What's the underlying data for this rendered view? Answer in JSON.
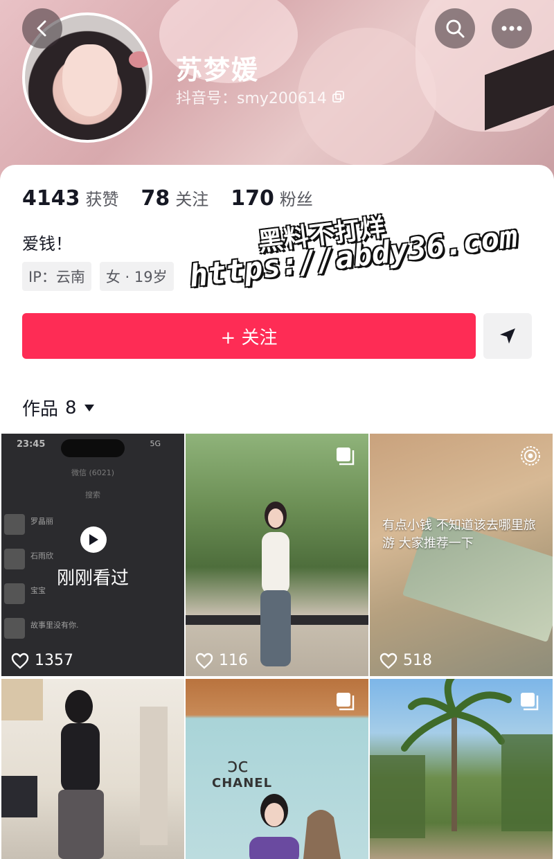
{
  "profile": {
    "name": "苏梦媛",
    "douyin_id": "抖音号：smy200614",
    "bio": "爱钱！",
    "tags": [
      "IP：云南",
      "女 · 19岁"
    ]
  },
  "stats": [
    {
      "num": "4143",
      "label": "获赞"
    },
    {
      "num": "78",
      "label": "关注"
    },
    {
      "num": "170",
      "label": "粉丝"
    }
  ],
  "actions": {
    "follow_label": "+ 关注"
  },
  "works": {
    "label": "作品",
    "count": "8"
  },
  "watermark": {
    "line1": "黑料不打烊",
    "line2": "https://abdy36.com"
  },
  "tiles": [
    {
      "likes": "1357",
      "overlay": "刚刚看过",
      "phone_time": "23:45",
      "phone_status": "5G",
      "wechat_title": "微信 (6021)",
      "search": "搜索",
      "chats": [
        "罗晶丽",
        "石雨欣",
        "宝宝",
        "故事里没有你."
      ]
    },
    {
      "likes": "116"
    },
    {
      "likes": "518",
      "caption": "有点小钱 不知道该去哪里旅游 大家推荐一下"
    },
    {},
    {
      "logo_text": "CHANEL"
    },
    {}
  ],
  "colors": {
    "accent": "#fe2c55",
    "text": "#161823",
    "muted": "#57585f",
    "tag_bg": "#f1f1f2"
  },
  "icons": [
    "back-icon",
    "search-icon",
    "more-icon",
    "copy-icon",
    "share-icon",
    "dropdown-icon",
    "heart-icon",
    "multi-image-icon",
    "live-icon",
    "play-icon"
  ]
}
